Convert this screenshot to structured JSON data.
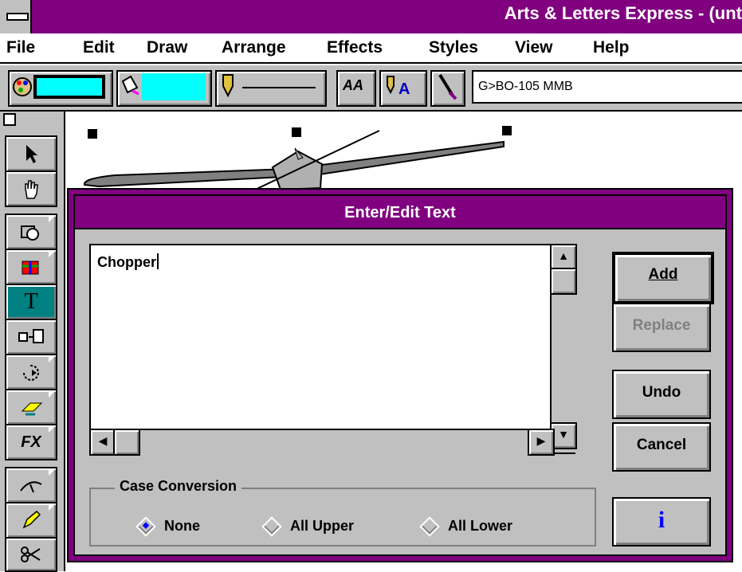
{
  "window": {
    "title": "Arts & Letters Express - (unt"
  },
  "menu": [
    "File",
    "Edit",
    "Draw",
    "Arrange",
    "Effects",
    "Styles",
    "View",
    "Help"
  ],
  "toolbar": {
    "style_name": "G>BO-105 MMB",
    "fill_color": "#00ffff",
    "font_button_label": "AA"
  },
  "toolbox": {
    "tools": [
      "pointer",
      "hand",
      "shapes",
      "symbols",
      "text",
      "transform",
      "rotate",
      "perspective",
      "effects",
      "line",
      "pencil",
      "scissors"
    ]
  },
  "dialog": {
    "title": "Enter/Edit Text",
    "text_value": "Chopper",
    "buttons": {
      "add": "Add",
      "replace": "Replace",
      "undo": "Undo",
      "cancel": "Cancel"
    },
    "case_conversion": {
      "label": "Case Conversion",
      "options": [
        "None",
        "All Upper",
        "All Lower"
      ],
      "selected": "None"
    }
  },
  "colors": {
    "title_bar": "#800080",
    "face": "#c0c0c0",
    "highlight": "#008080"
  }
}
